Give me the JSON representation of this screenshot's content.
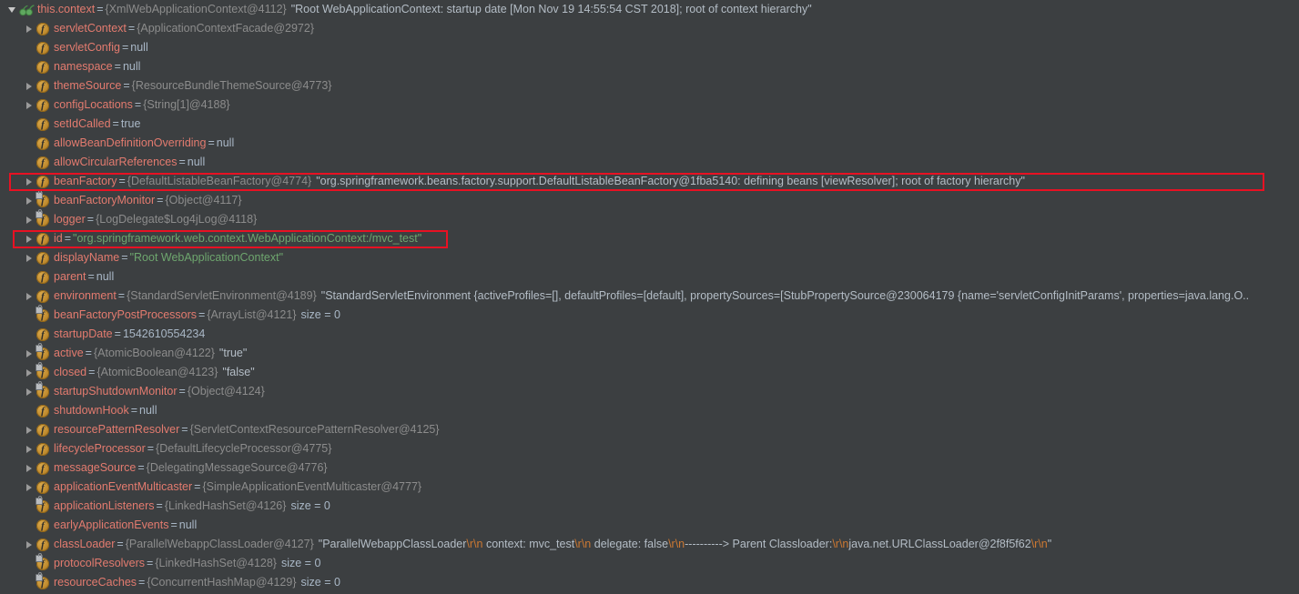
{
  "panel": {
    "title": "Debugger Variables",
    "theme_bg": "#3C3F41",
    "accent_name_color": "#E37B6F",
    "string_color": "#6EA66E",
    "type_color": "#8C8C8C",
    "escape_color": "#CC7832",
    "highlight_color": "#E81123"
  },
  "rows": [
    {
      "indent": 0,
      "arrow": "expanded",
      "icon": "watch-icon",
      "name": "this.context",
      "eq": "=",
      "type": "{XmlWebApplicationContext@4112}",
      "value": "\"Root WebApplicationContext: startup date [Mon Nov 19 14:55:54 CST 2018]; root of context hierarchy\"",
      "value_kind": "string_plain"
    },
    {
      "indent": 1,
      "arrow": "collapsed",
      "icon": "field-icon",
      "name": "servletContext",
      "eq": "=",
      "type": "{ApplicationContextFacade@2972}",
      "value": "",
      "value_kind": "none"
    },
    {
      "indent": 1,
      "arrow": "none",
      "icon": "field-icon",
      "name": "servletConfig",
      "eq": "=",
      "type": "",
      "value": "null",
      "value_kind": "plain"
    },
    {
      "indent": 1,
      "arrow": "none",
      "icon": "field-icon",
      "name": "namespace",
      "eq": "=",
      "type": "",
      "value": "null",
      "value_kind": "plain"
    },
    {
      "indent": 1,
      "arrow": "collapsed",
      "icon": "field-icon",
      "name": "themeSource",
      "eq": "=",
      "type": "{ResourceBundleThemeSource@4773}",
      "value": "",
      "value_kind": "none"
    },
    {
      "indent": 1,
      "arrow": "collapsed",
      "icon": "field-icon",
      "name": "configLocations",
      "eq": "=",
      "type": "{String[1]@4188}",
      "value": "",
      "value_kind": "none"
    },
    {
      "indent": 1,
      "arrow": "none",
      "icon": "field-icon",
      "name": "setIdCalled",
      "eq": "=",
      "type": "",
      "value": "true",
      "value_kind": "plain"
    },
    {
      "indent": 1,
      "arrow": "none",
      "icon": "field-icon",
      "name": "allowBeanDefinitionOverriding",
      "eq": "=",
      "type": "",
      "value": "null",
      "value_kind": "plain"
    },
    {
      "indent": 1,
      "arrow": "none",
      "icon": "field-icon",
      "name": "allowCircularReferences",
      "eq": "=",
      "type": "",
      "value": "null",
      "value_kind": "plain"
    },
    {
      "indent": 1,
      "arrow": "collapsed",
      "icon": "field-icon",
      "name": "beanFactory",
      "eq": "=",
      "type": "{DefaultListableBeanFactory@4774}",
      "value": "\"org.springframework.beans.factory.support.DefaultListableBeanFactory@1fba5140: defining beans [viewResolver]; root of factory hierarchy\"",
      "value_kind": "string_plain",
      "highlighted": true
    },
    {
      "indent": 1,
      "arrow": "collapsed",
      "icon": "private-field-icon",
      "name": "beanFactoryMonitor",
      "eq": "=",
      "type": "{Object@4117}",
      "value": "",
      "value_kind": "none"
    },
    {
      "indent": 1,
      "arrow": "collapsed",
      "icon": "private-field-icon",
      "name": "logger",
      "eq": "=",
      "type": "{LogDelegate$Log4jLog@4118}",
      "value": "",
      "value_kind": "none"
    },
    {
      "indent": 1,
      "arrow": "collapsed",
      "icon": "field-icon",
      "name": "id",
      "eq": "=",
      "type": "",
      "value": "\"org.springframework.web.context.WebApplicationContext:/mvc_test\"",
      "value_kind": "string_green",
      "highlighted": true
    },
    {
      "indent": 1,
      "arrow": "collapsed",
      "icon": "field-icon",
      "name": "displayName",
      "eq": "=",
      "type": "",
      "value": "\"Root WebApplicationContext\"",
      "value_kind": "string_green"
    },
    {
      "indent": 1,
      "arrow": "none",
      "icon": "field-icon",
      "name": "parent",
      "eq": "=",
      "type": "",
      "value": "null",
      "value_kind": "plain"
    },
    {
      "indent": 1,
      "arrow": "collapsed",
      "icon": "field-icon",
      "name": "environment",
      "eq": "=",
      "type": "{StandardServletEnvironment@4189}",
      "value": "\"StandardServletEnvironment {activeProfiles=[], defaultProfiles=[default], propertySources=[StubPropertySource@230064179 {name='servletConfigInitParams', properties=java.lang.O..",
      "value_kind": "string_plain"
    },
    {
      "indent": 1,
      "arrow": "none",
      "icon": "private-field-icon",
      "name": "beanFactoryPostProcessors",
      "eq": "=",
      "type": "{ArrayList@4121}",
      "value": "size = 0",
      "value_kind": "size"
    },
    {
      "indent": 1,
      "arrow": "none",
      "icon": "field-icon",
      "name": "startupDate",
      "eq": "=",
      "type": "",
      "value": "1542610554234",
      "value_kind": "plain"
    },
    {
      "indent": 1,
      "arrow": "collapsed",
      "icon": "private-field-icon",
      "name": "active",
      "eq": "=",
      "type": "{AtomicBoolean@4122}",
      "value": "\"true\"",
      "value_kind": "string_plain"
    },
    {
      "indent": 1,
      "arrow": "collapsed",
      "icon": "private-field-icon",
      "name": "closed",
      "eq": "=",
      "type": "{AtomicBoolean@4123}",
      "value": "\"false\"",
      "value_kind": "string_plain"
    },
    {
      "indent": 1,
      "arrow": "collapsed",
      "icon": "private-field-icon",
      "name": "startupShutdownMonitor",
      "eq": "=",
      "type": "{Object@4124}",
      "value": "",
      "value_kind": "none"
    },
    {
      "indent": 1,
      "arrow": "none",
      "icon": "field-icon",
      "name": "shutdownHook",
      "eq": "=",
      "type": "",
      "value": "null",
      "value_kind": "plain"
    },
    {
      "indent": 1,
      "arrow": "collapsed",
      "icon": "field-icon",
      "name": "resourcePatternResolver",
      "eq": "=",
      "type": "{ServletContextResourcePatternResolver@4125}",
      "value": "",
      "value_kind": "none"
    },
    {
      "indent": 1,
      "arrow": "collapsed",
      "icon": "field-icon",
      "name": "lifecycleProcessor",
      "eq": "=",
      "type": "{DefaultLifecycleProcessor@4775}",
      "value": "",
      "value_kind": "none"
    },
    {
      "indent": 1,
      "arrow": "collapsed",
      "icon": "field-icon",
      "name": "messageSource",
      "eq": "=",
      "type": "{DelegatingMessageSource@4776}",
      "value": "",
      "value_kind": "none"
    },
    {
      "indent": 1,
      "arrow": "collapsed",
      "icon": "field-icon",
      "name": "applicationEventMulticaster",
      "eq": "=",
      "type": "{SimpleApplicationEventMulticaster@4777}",
      "value": "",
      "value_kind": "none"
    },
    {
      "indent": 1,
      "arrow": "none",
      "icon": "private-field-icon",
      "name": "applicationListeners",
      "eq": "=",
      "type": "{LinkedHashSet@4126}",
      "value": "size = 0",
      "value_kind": "size"
    },
    {
      "indent": 1,
      "arrow": "none",
      "icon": "field-icon",
      "name": "earlyApplicationEvents",
      "eq": "=",
      "type": "",
      "value": "null",
      "value_kind": "plain"
    },
    {
      "indent": 1,
      "arrow": "collapsed",
      "icon": "field-icon",
      "name": "classLoader",
      "eq": "=",
      "type": "{ParallelWebappClassLoader@4127}",
      "value": "\"ParallelWebappClassLoader\\r\\n  context: mvc_test\\r\\n  delegate: false\\r\\n----------> Parent Classloader:\\r\\njava.net.URLClassLoader@2f8f5f62\\r\\n\"",
      "value_kind": "string_escaped"
    },
    {
      "indent": 1,
      "arrow": "none",
      "icon": "private-field-icon",
      "name": "protocolResolvers",
      "eq": "=",
      "type": "{LinkedHashSet@4128}",
      "value": "size = 0",
      "value_kind": "size"
    },
    {
      "indent": 1,
      "arrow": "none",
      "icon": "private-field-icon",
      "name": "resourceCaches",
      "eq": "=",
      "type": "{ConcurrentHashMap@4129}",
      "value": "size = 0",
      "value_kind": "size"
    }
  ],
  "annotations": [
    {
      "label": "beanFactory-highlight",
      "row_index": 9
    },
    {
      "label": "id-highlight",
      "row_index": 12
    }
  ]
}
